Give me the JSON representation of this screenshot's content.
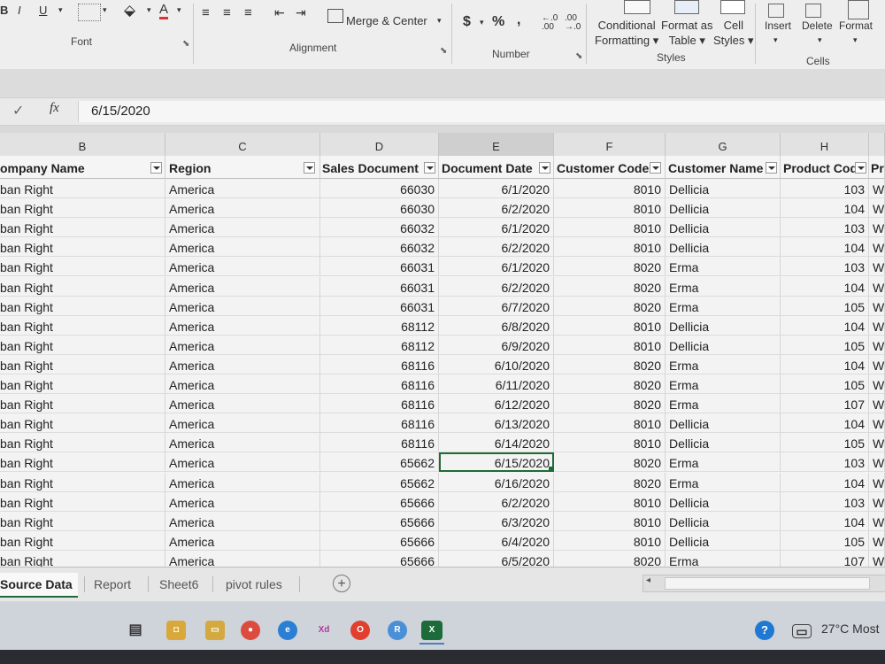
{
  "ribbon": {
    "font_controls": {
      "bold": "B",
      "italic": "I",
      "underline": "U",
      "font_color": "A"
    },
    "merge_center": "Merge & Center",
    "currency": "$",
    "percent": "%",
    "comma": ",",
    "conditional_formatting": [
      "Conditional",
      "Formatting"
    ],
    "format_as_table": [
      "Format as",
      "Table"
    ],
    "cell_styles": [
      "Cell",
      "Styles"
    ],
    "insert": "Insert",
    "delete": "Delete",
    "format": "Format",
    "groups": {
      "font": "Font",
      "alignment": "Alignment",
      "number": "Number",
      "styles": "Styles",
      "cells": "Cells"
    }
  },
  "formula_bar": {
    "value": "6/15/2020"
  },
  "columns": [
    "B",
    "C",
    "D",
    "E",
    "F",
    "G",
    "H"
  ],
  "headers": [
    "ompany Name",
    "Region",
    "Sales Document",
    "Document Date",
    "Customer Code",
    "Customer Name",
    "Product Cod",
    "Pr"
  ],
  "rows": [
    {
      "company": "ban Right",
      "region": "America",
      "doc": "66030",
      "date": "6/1/2020",
      "code": "8010",
      "name": "Dellicia",
      "prod": "103",
      "pr": "W"
    },
    {
      "company": "ban Right",
      "region": "America",
      "doc": "66030",
      "date": "6/2/2020",
      "code": "8010",
      "name": "Dellicia",
      "prod": "104",
      "pr": "W"
    },
    {
      "company": "ban Right",
      "region": "America",
      "doc": "66032",
      "date": "6/1/2020",
      "code": "8010",
      "name": "Dellicia",
      "prod": "103",
      "pr": "W"
    },
    {
      "company": "ban Right",
      "region": "America",
      "doc": "66032",
      "date": "6/2/2020",
      "code": "8010",
      "name": "Dellicia",
      "prod": "104",
      "pr": "W"
    },
    {
      "company": "ban Right",
      "region": "America",
      "doc": "66031",
      "date": "6/1/2020",
      "code": "8020",
      "name": "Erma",
      "prod": "103",
      "pr": "W"
    },
    {
      "company": "ban Right",
      "region": "America",
      "doc": "66031",
      "date": "6/2/2020",
      "code": "8020",
      "name": "Erma",
      "prod": "104",
      "pr": "W"
    },
    {
      "company": "ban Right",
      "region": "America",
      "doc": "66031",
      "date": "6/7/2020",
      "code": "8020",
      "name": "Erma",
      "prod": "105",
      "pr": "W"
    },
    {
      "company": "ban Right",
      "region": "America",
      "doc": "68112",
      "date": "6/8/2020",
      "code": "8010",
      "name": "Dellicia",
      "prod": "104",
      "pr": "W"
    },
    {
      "company": "ban Right",
      "region": "America",
      "doc": "68112",
      "date": "6/9/2020",
      "code": "8010",
      "name": "Dellicia",
      "prod": "105",
      "pr": "W"
    },
    {
      "company": "ban Right",
      "region": "America",
      "doc": "68116",
      "date": "6/10/2020",
      "code": "8020",
      "name": "Erma",
      "prod": "104",
      "pr": "W"
    },
    {
      "company": "ban Right",
      "region": "America",
      "doc": "68116",
      "date": "6/11/2020",
      "code": "8020",
      "name": "Erma",
      "prod": "105",
      "pr": "W"
    },
    {
      "company": "ban Right",
      "region": "America",
      "doc": "68116",
      "date": "6/12/2020",
      "code": "8020",
      "name": "Erma",
      "prod": "107",
      "pr": "W"
    },
    {
      "company": "ban Right",
      "region": "America",
      "doc": "68116",
      "date": "6/13/2020",
      "code": "8010",
      "name": "Dellicia",
      "prod": "104",
      "pr": "W"
    },
    {
      "company": "ban Right",
      "region": "America",
      "doc": "68116",
      "date": "6/14/2020",
      "code": "8010",
      "name": "Dellicia",
      "prod": "105",
      "pr": "W"
    },
    {
      "company": "ban Right",
      "region": "America",
      "doc": "65662",
      "date": "6/15/2020",
      "code": "8020",
      "name": "Erma",
      "prod": "103",
      "pr": "W"
    },
    {
      "company": "ban Right",
      "region": "America",
      "doc": "65662",
      "date": "6/16/2020",
      "code": "8020",
      "name": "Erma",
      "prod": "104",
      "pr": "W"
    },
    {
      "company": "ban Right",
      "region": "America",
      "doc": "65666",
      "date": "6/2/2020",
      "code": "8010",
      "name": "Dellicia",
      "prod": "103",
      "pr": "W"
    },
    {
      "company": "ban Right",
      "region": "America",
      "doc": "65666",
      "date": "6/3/2020",
      "code": "8010",
      "name": "Dellicia",
      "prod": "104",
      "pr": "W"
    },
    {
      "company": "ban Right",
      "region": "America",
      "doc": "65666",
      "date": "6/4/2020",
      "code": "8010",
      "name": "Dellicia",
      "prod": "105",
      "pr": "W"
    },
    {
      "company": "ban Right",
      "region": "America",
      "doc": "65666",
      "date": "6/5/2020",
      "code": "8020",
      "name": "Erma",
      "prod": "107",
      "pr": "W"
    }
  ],
  "sheet_tabs": [
    "Source Data",
    "Report",
    "Sheet6",
    "pivot rules"
  ],
  "taskbar": {
    "weather": "27°C",
    "weather_text": "Most",
    "apps": [
      "Xd",
      "R",
      "X"
    ]
  }
}
